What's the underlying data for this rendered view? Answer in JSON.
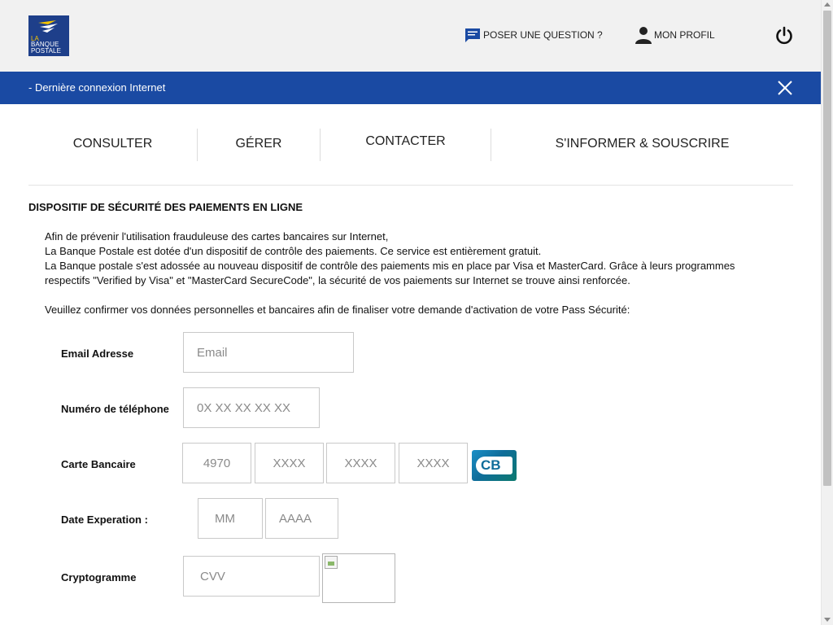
{
  "brand": {
    "logo_line1": "LA",
    "logo_line2": "BANQUE",
    "logo_line3": "POSTALE"
  },
  "header": {
    "question_label": "POSER UNE QUESTION ?",
    "profile_label": "MON PROFIL",
    "question_icon": "chat-icon",
    "profile_icon": "user-icon",
    "power_icon": "power-icon"
  },
  "banner": {
    "text": "- Dernière connexion Internet",
    "close_icon": "close-icon"
  },
  "nav": {
    "items": [
      {
        "label": "CONSULTER"
      },
      {
        "label": "GÉRER"
      },
      {
        "label": "CONTACTER"
      },
      {
        "label": "S'INFORMER & SOUSCRIRE"
      }
    ]
  },
  "section": {
    "title": "DISPOSITIF DE SÉCURITÉ DES PAIEMENTS EN LIGNE",
    "intro": [
      "Afin de prévenir l'utilisation frauduleuse des cartes bancaires sur Internet,",
      "La Banque Postale est dotée d'un dispositif de contrôle des paiements. Ce service est entièrement gratuit.",
      "La Banque postale s'est adossée au nouveau dispositif de contrôle des paiements mis en place par Visa et MasterCard. Grâce à leurs programmes respectifs \"Verified by Visa\" et \"MasterCard SecureCode\", la sécurité de vos paiements sur Internet se trouve ainsi renforcée."
    ],
    "instruction": "Veuillez confirmer vos données personnelles et bancaires afin de finaliser votre demande d'activation de votre Pass Sécurité:"
  },
  "form": {
    "email": {
      "label": "Email Adresse",
      "placeholder": "Email"
    },
    "phone": {
      "label": "Numéro de téléphone",
      "placeholder": "0X XX XX XX XX"
    },
    "card": {
      "label": "Carte Bancaire",
      "p1": "4970",
      "p2": "XXXX",
      "p3": "XXXX",
      "p4": "XXXX",
      "logo_text": "CB"
    },
    "expiry": {
      "label": "Date Experation :",
      "month": "MM",
      "year": "AAAA"
    },
    "cvv": {
      "label": "Cryptogramme",
      "placeholder": "CVV"
    }
  },
  "colors": {
    "banner": "#1a4aa3",
    "logo_bg": "#1e3f8a",
    "logo_accent": "#f5c400"
  }
}
